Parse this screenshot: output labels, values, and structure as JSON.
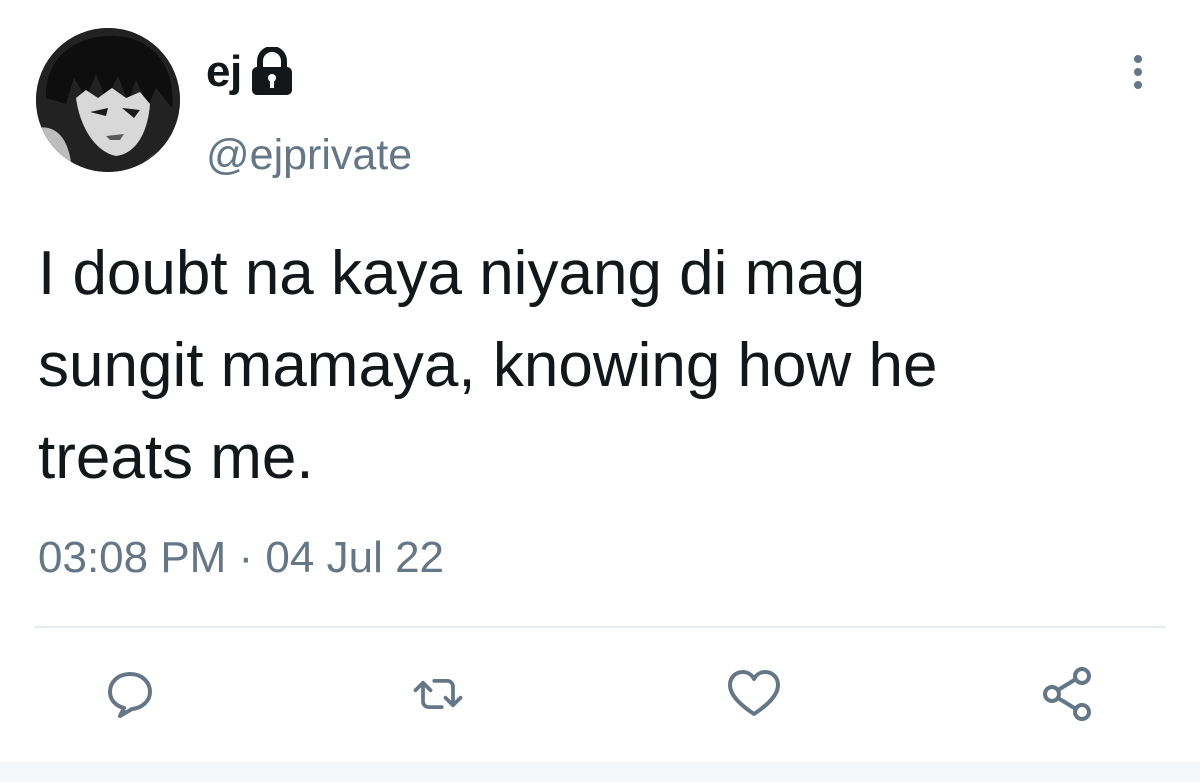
{
  "user": {
    "display_name": "ej",
    "handle": "@ejprivate",
    "protected_icon": "lock-icon",
    "avatar_icon": "anime-character-avatar"
  },
  "tweet": {
    "text": "I doubt na kaya niyang di mag\nsungit mamaya, knowing how he\ntreats me.",
    "timestamp": "03:08 PM · 04 Jul 22"
  },
  "actions": [
    {
      "name": "reply",
      "icon": "comment-icon"
    },
    {
      "name": "retweet",
      "icon": "retweet-icon"
    },
    {
      "name": "like",
      "icon": "heart-icon"
    },
    {
      "name": "share",
      "icon": "share-icon"
    }
  ],
  "menu": {
    "icon": "more-vertical-icon"
  },
  "colors": {
    "text": "#14171a",
    "secondary": "#657786",
    "divider": "#e6ecf0",
    "background": "#ffffff"
  }
}
